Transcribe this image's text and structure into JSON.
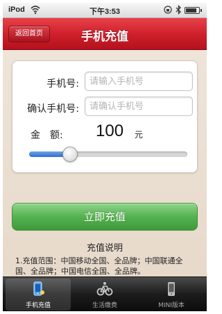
{
  "status_bar": {
    "carrier": "iPod",
    "time": "下午3:53",
    "battery_level": 0.85
  },
  "nav": {
    "back_label": "返回首页",
    "title": "手机充值"
  },
  "form": {
    "phone_label": "手机号:",
    "phone_placeholder": "请输入手机号",
    "confirm_label": "确认手机号:",
    "confirm_placeholder": "请确认手机号",
    "amount_label": "金　额:",
    "amount_value": "100",
    "amount_unit": "元",
    "slider_fraction": 0.26
  },
  "submit_label": "立即充值",
  "info": {
    "title": "充值说明",
    "text": "1.充值范围：中国移动全国、全品牌；中国联通全国、全品牌；中国电信全国、全品牌。"
  },
  "tabs": [
    {
      "label": "手机充值",
      "icon": "phone-icon",
      "active": true
    },
    {
      "label": "生活缴费",
      "icon": "bicycle-icon",
      "active": false
    },
    {
      "label": "MINI版本",
      "icon": "mini-phone-icon",
      "active": false
    }
  ],
  "colors": {
    "nav_red": "#cc1f2a",
    "submit_green": "#55b250",
    "slider_blue": "#2c6fcf"
  }
}
